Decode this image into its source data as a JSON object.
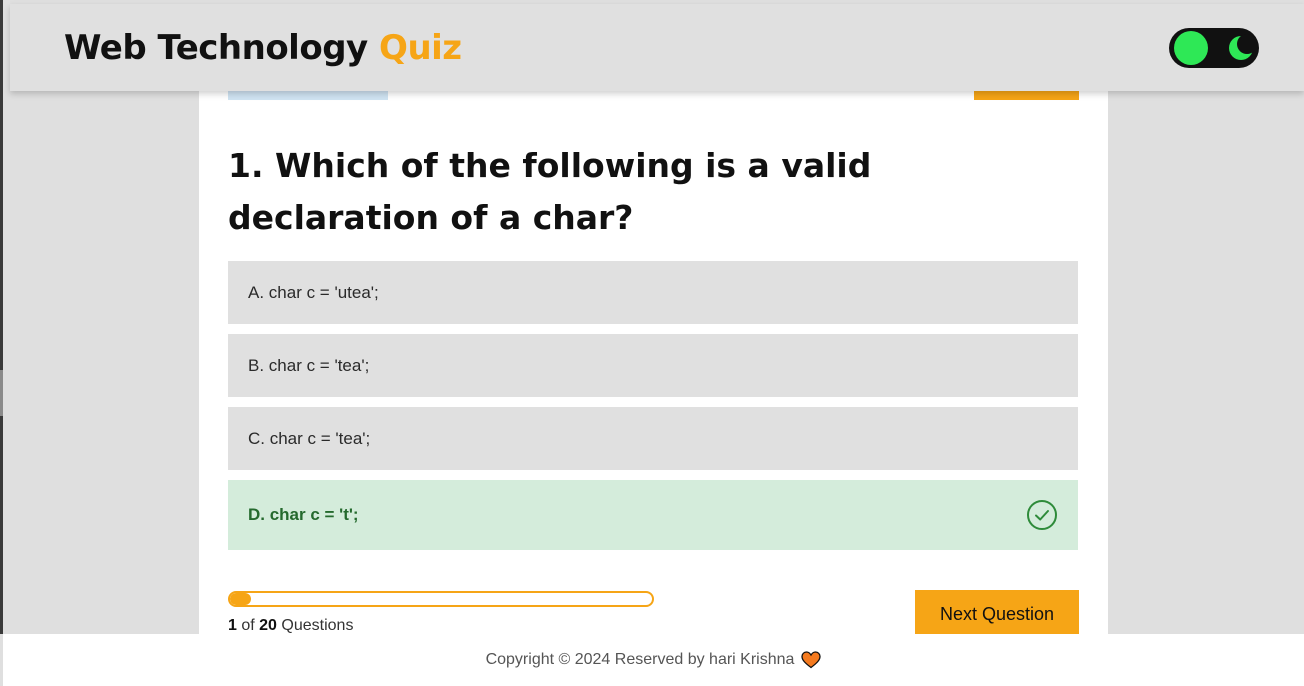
{
  "header": {
    "brand_main": "Web Technology",
    "brand_accent": "Quiz"
  },
  "theme_toggle": {
    "knob_icon": "circle-knob-icon",
    "moon_icon": "moon-icon",
    "knob_color": "#2ee856",
    "track_color": "#111111"
  },
  "quiz": {
    "question": "1. Which of the following is a valid declaration of a char?",
    "options": [
      {
        "label": "A. char c = 'utea';",
        "correct": false
      },
      {
        "label": "B. char c = 'tea';",
        "correct": false
      },
      {
        "label": "C. char c = 'tea';",
        "correct": false
      },
      {
        "label": "D. char c = 't';",
        "correct": true
      }
    ],
    "correct_icon": "check-circle-icon",
    "progress": {
      "current": "1",
      "of": "of",
      "total": "20",
      "suffix": "Questions",
      "fraction": 0.05
    },
    "next_label": "Next Question"
  },
  "footer": {
    "text": "Copyright © 2024 Reserved by hari Krishna",
    "heart_icon": "heart-icon"
  },
  "colors": {
    "accent": "#f6a516",
    "correct_bg": "#d4ecdb",
    "correct_text": "#256a2e",
    "page_bg": "#dfdfdf"
  }
}
